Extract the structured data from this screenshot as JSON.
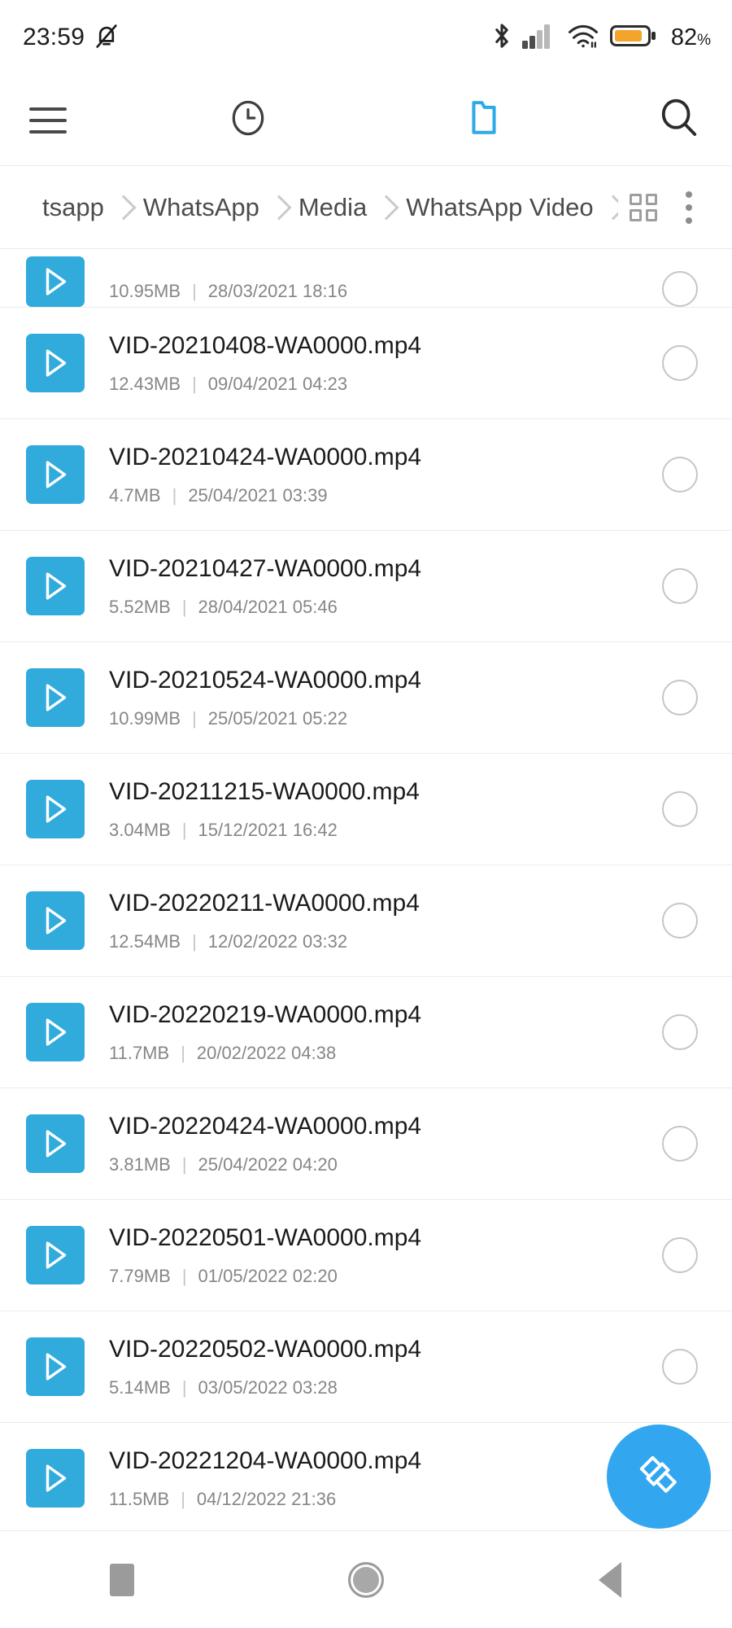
{
  "status_bar": {
    "time": "23:59",
    "mute_icon": "bell-muted-icon",
    "bluetooth_icon": "bluetooth-icon",
    "signal_icon": "cellular-signal-icon",
    "wifi_icon": "wifi-icon",
    "battery_icon": "battery-icon",
    "battery_level": "82",
    "battery_unit": "%",
    "battery_color": "#F2A42C"
  },
  "toolbar": {
    "menu_label": "menu-icon",
    "recent_label": "clock-icon",
    "folder_label": "folder-icon",
    "search_label": "search-icon",
    "active_color": "#2DAAE8",
    "inactive_color": "#3f3f3f"
  },
  "breadcrumb": {
    "items": [
      "tsapp",
      "WhatsApp",
      "Media",
      "WhatsApp Video"
    ],
    "grid_view_icon": "grid-view-icon",
    "overflow_icon": "more-vertical-icon"
  },
  "files": [
    {
      "name": "",
      "size": "10.95MB",
      "date": "28/03/2021 18:16",
      "partial": true
    },
    {
      "name": "VID-20210408-WA0000.mp4",
      "size": "12.43MB",
      "date": "09/04/2021 04:23",
      "partial": false
    },
    {
      "name": "VID-20210424-WA0000.mp4",
      "size": "4.7MB",
      "date": "25/04/2021 03:39",
      "partial": false
    },
    {
      "name": "VID-20210427-WA0000.mp4",
      "size": "5.52MB",
      "date": "28/04/2021 05:46",
      "partial": false
    },
    {
      "name": "VID-20210524-WA0000.mp4",
      "size": "10.99MB",
      "date": "25/05/2021 05:22",
      "partial": false
    },
    {
      "name": "VID-20211215-WA0000.mp4",
      "size": "3.04MB",
      "date": "15/12/2021 16:42",
      "partial": false
    },
    {
      "name": "VID-20220211-WA0000.mp4",
      "size": "12.54MB",
      "date": "12/02/2022 03:32",
      "partial": false
    },
    {
      "name": "VID-20220219-WA0000.mp4",
      "size": "11.7MB",
      "date": "20/02/2022 04:38",
      "partial": false
    },
    {
      "name": "VID-20220424-WA0000.mp4",
      "size": "3.81MB",
      "date": "25/04/2022 04:20",
      "partial": false
    },
    {
      "name": "VID-20220501-WA0000.mp4",
      "size": "7.79MB",
      "date": "01/05/2022 02:20",
      "partial": false
    },
    {
      "name": "VID-20220502-WA0000.mp4",
      "size": "5.14MB",
      "date": "03/05/2022 03:28",
      "partial": false
    },
    {
      "name": "VID-20221204-WA0000.mp4",
      "size": "11.5MB",
      "date": "04/12/2022 21:36",
      "partial": false
    }
  ],
  "file_meta_separator": "|",
  "file_icon_name": "video-play-icon",
  "file_icon_color": "#30ABDC",
  "selection_control": "unselected-radio",
  "fab": {
    "icon": "paintbrush-clean-icon",
    "color": "#32A7F0"
  },
  "navbar": {
    "recents_icon": "recents-square-icon",
    "home_icon": "home-circle-icon",
    "back_icon": "back-triangle-icon"
  }
}
